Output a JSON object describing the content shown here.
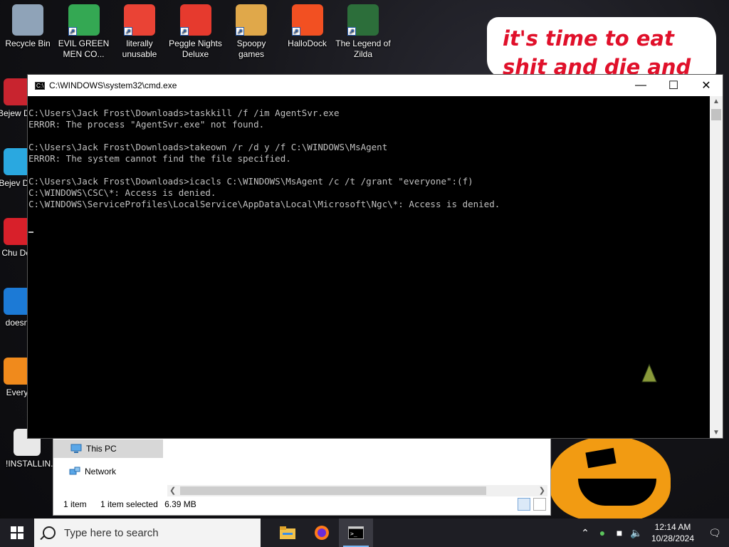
{
  "desktop": {
    "icons_top": [
      {
        "label": "Recycle Bin",
        "icon": "recycle-bin-icon",
        "shortcut": false,
        "color": "#8fa3b8"
      },
      {
        "label": "EVIL GREEN MEN CO...",
        "icon": "green-men-icon",
        "shortcut": true,
        "color": "#34a853"
      },
      {
        "label": "literally unusable",
        "icon": "chrome-icon",
        "shortcut": true,
        "color": "#ea4335"
      },
      {
        "label": "Peggle Nights Deluxe",
        "icon": "peggle-icon",
        "shortcut": true,
        "color": "#e63a2e"
      },
      {
        "label": "Spoopy games",
        "icon": "folder-icon",
        "shortcut": true,
        "color": "#e0a84a"
      },
      {
        "label": "HalloDock",
        "icon": "windows-logo-icon",
        "shortcut": true,
        "color": "#f25022"
      },
      {
        "label": "The Legend of Zilda",
        "icon": "zelda-icon",
        "shortcut": true,
        "color": "#2c6e3a"
      }
    ],
    "icons_left": [
      {
        "label": "Bejew Del",
        "icon": "bejeweled-icon",
        "color": "#c8242f"
      },
      {
        "label": "Bejev Del",
        "icon": "bejeweled-twist-icon",
        "color": "#2aa8e0"
      },
      {
        "label": "Chu Del",
        "icon": "chuzzle-icon",
        "color": "#d8202a"
      },
      {
        "label": "doesn",
        "icon": "blue-app-icon",
        "color": "#1c7ad6"
      },
      {
        "label": "Every",
        "icon": "everything-icon",
        "color": "#f08a1c"
      },
      {
        "label": "!INSTALLIN...",
        "icon": "text-file-icon",
        "color": "#e8e8e8"
      }
    ],
    "meme_text": "it's time to eat shit and die and go trick"
  },
  "explorer": {
    "nav": [
      {
        "label": "This PC",
        "icon": "computer-icon"
      },
      {
        "label": "Network",
        "icon": "network-icon"
      }
    ],
    "status": {
      "item_count": "1 item",
      "selected": "1 item selected",
      "size": "6.39 MB"
    }
  },
  "cmd": {
    "title": "C:\\WINDOWS\\system32\\cmd.exe",
    "lines": [
      "C:\\Users\\Jack Frost\\Downloads>taskkill /f /im AgentSvr.exe",
      "ERROR: The process \"AgentSvr.exe\" not found.",
      "",
      "C:\\Users\\Jack Frost\\Downloads>takeown /r /d y /f C:\\WINDOWS\\MsAgent",
      "ERROR: The system cannot find the file specified.",
      "",
      "C:\\Users\\Jack Frost\\Downloads>icacls C:\\WINDOWS\\MsAgent /c /t /grant \"everyone\":(f)",
      "C:\\WINDOWS\\CSC\\*: Access is denied.",
      "C:\\WINDOWS\\ServiceProfiles\\LocalService\\AppData\\Local\\Microsoft\\Ngc\\*: Access is denied.",
      ""
    ]
  },
  "taskbar": {
    "search_placeholder": "Type here to search",
    "apps": [
      {
        "name": "file-explorer-icon",
        "active": false
      },
      {
        "name": "firefox-icon",
        "active": false
      },
      {
        "name": "cmd-icon",
        "active": true
      }
    ],
    "time": "12:14 AM",
    "date": "10/28/2024"
  }
}
